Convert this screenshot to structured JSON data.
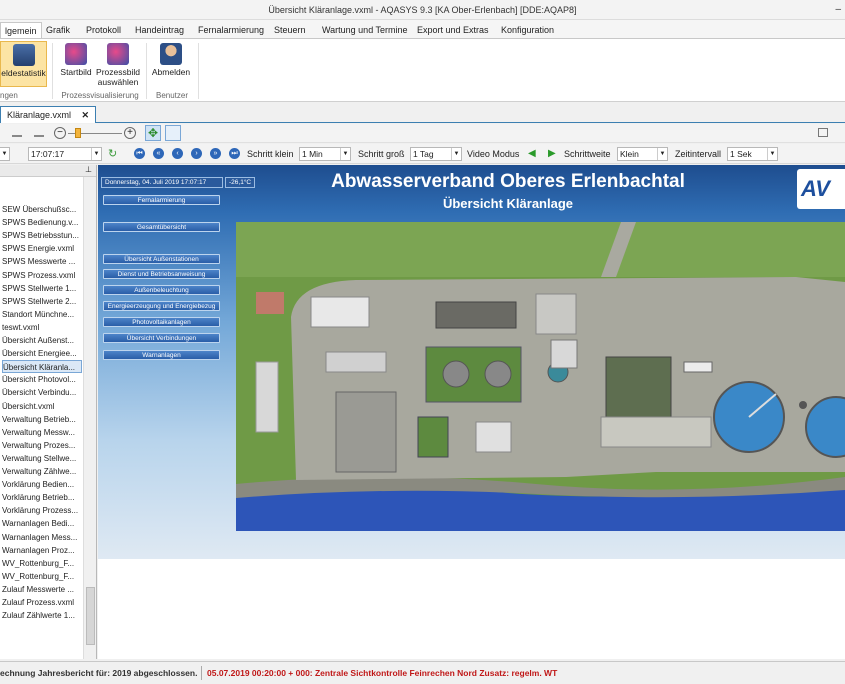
{
  "window": {
    "title": "Übersicht Kläranlage.vxml - AQASYS 9.3 [KA Ober-Erlenbach] [DDE:AQAP8]"
  },
  "menu": [
    "lgemein",
    "Grafik",
    "Protokoll",
    "Handeintrag",
    "Fernalarmierung",
    "Steuern",
    "Wartung und Termine",
    "Export und Extras",
    "Konfiguration"
  ],
  "ribbon": {
    "buttons": [
      {
        "label": "eldestatistik",
        "selected": true
      },
      {
        "label": "Startbild"
      },
      {
        "label": "Prozessbild auswählen"
      },
      {
        "label": "Abmelden"
      }
    ],
    "groups": [
      "ngen",
      "Prozessvisualisierung",
      "Benutzer"
    ]
  },
  "doctab": {
    "label": "Kläranlage.vxml",
    "close": "✕"
  },
  "toolbar2": {
    "time": "17:07:17",
    "schritt_klein_label": "Schritt klein",
    "schritt_klein_value": "1 Min",
    "schritt_gross_label": "Schritt groß",
    "schritt_gross_value": "1 Tag",
    "video_label": "Video Modus",
    "schrittweite_label": "Schrittweite",
    "schrittweite_value": "Klein",
    "zeitintervall_label": "Zeitintervall",
    "zeitintervall_value": "1 Sek"
  },
  "files": [
    "SEW Überschußsc...",
    "SPWS Bedienung.v...",
    "SPWS Betriebsstun...",
    "SPWS Energie.vxml",
    "SPWS Messwerte ...",
    "SPWS Prozess.vxml",
    "SPWS Stellwerte 1...",
    "SPWS Stellwerte 2...",
    "Standort Münchne...",
    "teswt.vxml",
    "Übersicht Außenst...",
    "Übersicht Energiee...",
    "Übersicht Kläranla...",
    "Übersicht Photovol...",
    "Übersicht Verbindu...",
    "Übersicht.vxml",
    "Verwaltung Betrieb...",
    "Verwaltung Messw...",
    "Verwaltung Prozes...",
    "Verwaltung Stellwe...",
    "Verwaltung Zählwe...",
    "Vorklärung Bedien...",
    "Vorklärung Betrieb...",
    "Vorklärung Prozess...",
    "Warnanlagen Bedi...",
    "Warnanlagen Mess...",
    "Warnanlagen Proz...",
    "WV_Rottenburg_F...",
    "WV_Rottenburg_F...",
    "Zulauf Messwerte ...",
    "Zulauf Prozess.vxml",
    "Zulauf Zählwerte 1..."
  ],
  "selected_file_index": 12,
  "viz": {
    "date": "Donnerstag, 04. Juli 2019 17:07:17",
    "temp": "-26,1°C",
    "title": "Abwasserverband Oberes Erlenbachtal",
    "subtitle": "Übersicht Kläranlage",
    "logo": "AV",
    "nav_top": [
      "Fernalarmierung",
      "Gesamtübersicht"
    ],
    "nav": [
      "Übersicht Außenstationen",
      "Dienst und Betriebsanweisung",
      "Außenbeleuchtung",
      "Energieerzeugung und Energiebezug",
      "Photovoltaikanlagen",
      "Übersicht Verbindungen",
      "Warnanlagen"
    ]
  },
  "status": {
    "left": "echnung Jahresbericht für: 2019 abgeschlossen.",
    "right": "05.07.2019 00:20:00 + 000:  Zentrale Sichtkontrolle Feinrechen Nord Zusatz: regelm. WT"
  }
}
